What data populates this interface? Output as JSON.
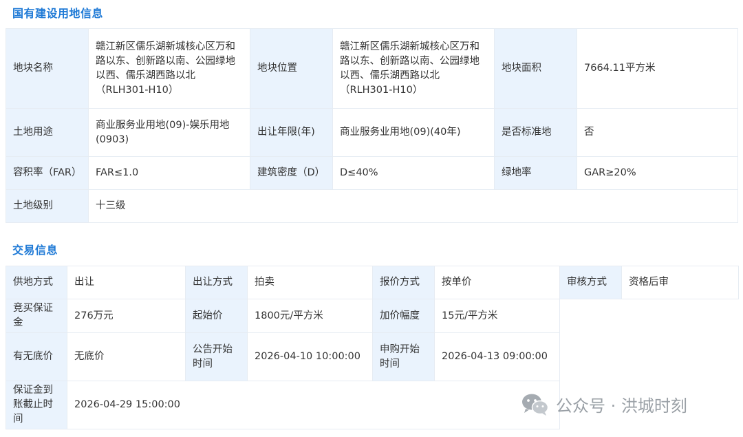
{
  "land_info": {
    "title": "国有建设用地信息",
    "rows": [
      [
        {
          "label": "地块名称",
          "value": "赣江新区儒乐湖新城核心区万和路以东、创新路以南、公园绿地以西、儒乐湖西路以北（RLH301-H10）"
        },
        {
          "label": "地块位置",
          "value": "赣江新区儒乐湖新城核心区万和路以东、创新路以南、公园绿地以西、儒乐湖西路以北（RLH301-H10）"
        },
        {
          "label": "地块面积",
          "value": "7664.11平方米"
        }
      ],
      [
        {
          "label": "土地用途",
          "value": "商业服务业用地(09)-娱乐用地(0903)"
        },
        {
          "label": "出让年限(年)",
          "value": "商业服务业用地(09)(40年)"
        },
        {
          "label": "是否标准地",
          "value": "否"
        }
      ],
      [
        {
          "label": "容积率（FAR）",
          "value": "FAR≤1.0"
        },
        {
          "label": "建筑密度（D）",
          "value": "D≤40%"
        },
        {
          "label": "绿地率",
          "value": "GAR≥20%"
        }
      ],
      [
        {
          "label": "土地级别",
          "value": "十三级"
        }
      ]
    ]
  },
  "trade_info": {
    "title": "交易信息",
    "rows": [
      [
        {
          "label": "供地方式",
          "value": "出让"
        },
        {
          "label": "出让方式",
          "value": "拍卖"
        },
        {
          "label": "报价方式",
          "value": "按单价"
        },
        {
          "label": "审核方式",
          "value": "资格后审"
        }
      ],
      [
        {
          "label": "竞买保证金",
          "value": "276万元"
        },
        {
          "label": "起始价",
          "value": "1800元/平方米"
        },
        {
          "label": "加价幅度",
          "value": "15元/平方米"
        }
      ],
      [
        {
          "label": "有无底价",
          "value": "无底价"
        },
        {
          "label": "公告开始时间",
          "value": "2026-04-10 10:00:00"
        },
        {
          "label": "申购开始时间",
          "value": "2026-04-13 09:00:00"
        }
      ],
      [
        {
          "label": "保证金到账截止时间",
          "value": "2026-04-29 15:00:00"
        }
      ]
    ]
  },
  "watermark": {
    "text": "公众号 · 洪城时刻",
    "icon": "wechat-icon",
    "color": "#9aa0a6"
  },
  "colors": {
    "accent": "#1f7ad6",
    "label_bg": "#eaf3fd",
    "border": "#e6ecf3"
  }
}
